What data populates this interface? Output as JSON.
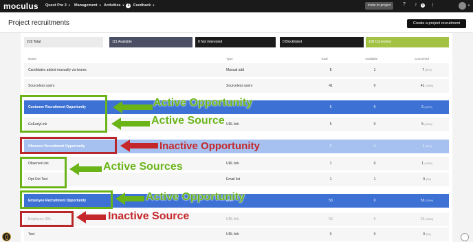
{
  "nav": {
    "logo": "moculus",
    "project_menu": "Quest Pro 3",
    "management_menu": "Management",
    "activities_menu": "Activities",
    "activities_badge": "1",
    "feedback_menu": "Feedback",
    "invite_label": "Invite to project",
    "notification_count": "1"
  },
  "page": {
    "title": "Project recruitments",
    "create_label": "Create a project recruitment"
  },
  "stats": {
    "total": "219 Total",
    "available": "111 Available",
    "not_interested": "0 Not interested",
    "blocklisted": "0 Blocklisted",
    "converted": "108 Converted"
  },
  "columns": {
    "name": "Name",
    "type": "Type",
    "total": "Total",
    "available": "Available",
    "converted": "Converted"
  },
  "rows": [
    {
      "name": "Candidates added manually via teams",
      "type": "Manual add",
      "total": "8",
      "available": "1",
      "converted": "7",
      "pct": "(87%)"
    },
    {
      "name": "Sourceless users",
      "type": "Sourceless users",
      "total": "41",
      "available": "0",
      "converted": "41",
      "pct": "(100%)"
    },
    {
      "name": "Customer Recruitment Opportunity",
      "type": "",
      "total": "5",
      "available": "0",
      "converted": "5",
      "pct": "(100%)"
    },
    {
      "name": "GoEarlyLink",
      "type": "URL link",
      "total": "5",
      "available": "0",
      "converted": "5",
      "pct": "(100%)"
    },
    {
      "name": "Observer Recruitment Opportunity",
      "type": "",
      "total": "2",
      "available": "1",
      "converted": "1",
      "pct": "(50%)"
    },
    {
      "name": "ObserverLink",
      "type": "URL link",
      "total": "1",
      "available": "0",
      "converted": "1",
      "pct": "(100%)"
    },
    {
      "name": "Opt-Out Test",
      "type": "Email list",
      "total": "1",
      "available": "1",
      "converted": "0",
      "pct": "(0%)"
    },
    {
      "name": "Employee Recruitment Opportunity",
      "type": "ants",
      "total": "53",
      "available": "0",
      "converted": "53",
      "pct": "(100%)"
    },
    {
      "name": "Employee URL",
      "type": "URL link",
      "total": "53",
      "available": "0",
      "converted": "53",
      "pct": "(100%)"
    },
    {
      "name": "Test",
      "type": "URL link",
      "total": "0",
      "available": "0",
      "converted": "0",
      "pct": "(0%)"
    }
  ],
  "annotations": {
    "active_opportunity_1": "Active Opportunity",
    "active_source": "Active Source",
    "inactive_opportunity": "Inactive Opportunity",
    "active_sources": "Active Sources",
    "active_opportunity_2": "Active Opportunity",
    "inactive_source": "Inactive Source"
  },
  "colors": {
    "annotation_green": "#6ab418",
    "annotation_red": "#b8282a",
    "opportunity_active": "#3d72d4",
    "opportunity_inactive": "#a6c1ef",
    "converted_stat": "#a3c143"
  }
}
